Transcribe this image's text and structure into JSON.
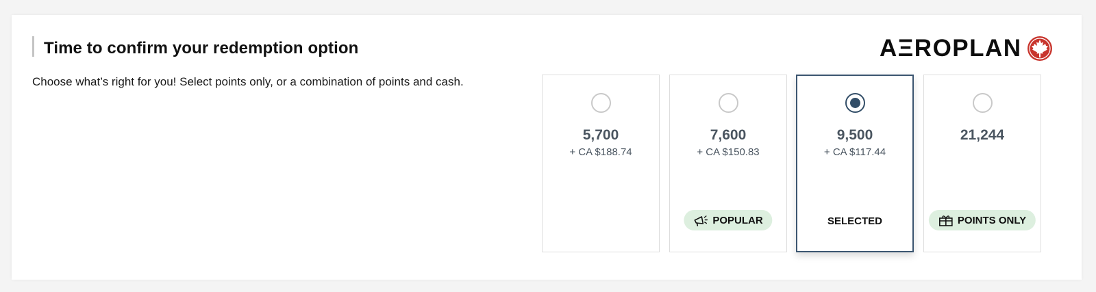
{
  "header": {
    "title": "Time to confirm your redemption option",
    "subtitle": "Choose what’s right for you! Select points only, or a combination of points and cash.",
    "logo_text": "AΞROPLAN"
  },
  "options": [
    {
      "points": "5,700",
      "cash": "+ CA $188.74",
      "selected": false,
      "badge": ""
    },
    {
      "points": "7,600",
      "cash": "+ CA $150.83",
      "selected": false,
      "badge": "POPULAR",
      "badge_icon": "megaphone-icon"
    },
    {
      "points": "9,500",
      "cash": "+ CA $117.44",
      "selected": true,
      "status_label": "SELECTED"
    },
    {
      "points": "21,244",
      "cash": "",
      "selected": false,
      "badge": "POINTS ONLY",
      "badge_icon": "gift-icon"
    }
  ],
  "colors": {
    "selected_border": "#3b5570",
    "radio_selected": "#334e68",
    "badge_bg": "#ddefdf",
    "logo_red": "#c8352d"
  }
}
